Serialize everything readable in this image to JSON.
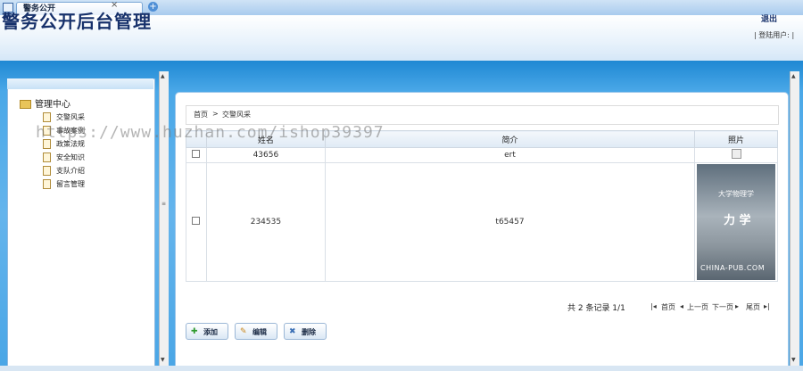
{
  "tabs": [
    {
      "label": "警务公开",
      "close": "×"
    }
  ],
  "new_tab_icon": "plus-icon",
  "header": {
    "title": "警务公开后台管理",
    "logout": "退出",
    "user_info": "| 登陆用户: |"
  },
  "sidebar": {
    "root": "管理中心",
    "items": [
      {
        "label": "交警风采"
      },
      {
        "label": "事故案例"
      },
      {
        "label": "政策法规"
      },
      {
        "label": "安全知识"
      },
      {
        "label": "支队介绍"
      },
      {
        "label": "留言管理"
      }
    ]
  },
  "breadcrumb": {
    "home": "首页",
    "sep": ">",
    "current": "交警风采"
  },
  "table": {
    "headers": [
      "",
      "姓名",
      "简介",
      "照片"
    ],
    "rows": [
      {
        "name": "43656",
        "intro": "ert",
        "photo": "broken"
      },
      {
        "name": "234535",
        "intro": "t65457",
        "photo": "cover"
      }
    ],
    "cover": {
      "line1": "大学物理学",
      "line2": "力 学",
      "line3": "CHINA-PUB.COM"
    }
  },
  "paging": {
    "summary": "共 2 条记录 1/1",
    "first": "首页",
    "prev": "上一页",
    "next": "下一页",
    "last": "尾页"
  },
  "buttons": {
    "add": "添加",
    "edit": "编辑",
    "delete": "删除"
  },
  "watermark": "https://www.huzhan.com/ishop39397",
  "colors": {
    "accent": "#1f88d3",
    "title": "#17316b"
  }
}
